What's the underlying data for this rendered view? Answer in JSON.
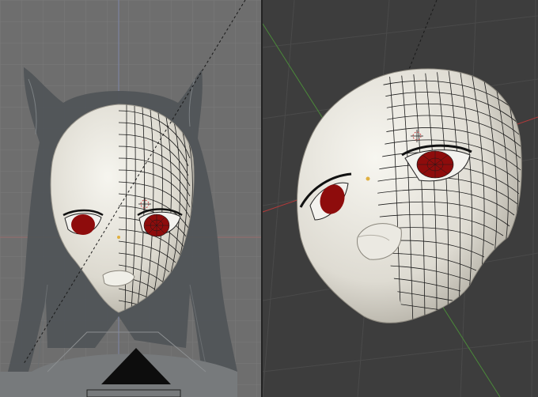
{
  "viewports": {
    "left": {
      "name": "front-orthographic-view"
    },
    "right": {
      "name": "perspective-view"
    }
  },
  "colors": {
    "left_bg": "#6e6e6e",
    "right_bg": "#3d3d3d",
    "skin": "#e8e6de",
    "iris": "#8e0c0c",
    "wire": "#1a1a1a",
    "hair": "#4f5457",
    "x_axis": "#b33a3a",
    "y_axis": "#4b8a3a"
  },
  "icons": {
    "cursor": "3d-cursor-icon",
    "camera": "camera-triangle-icon"
  }
}
